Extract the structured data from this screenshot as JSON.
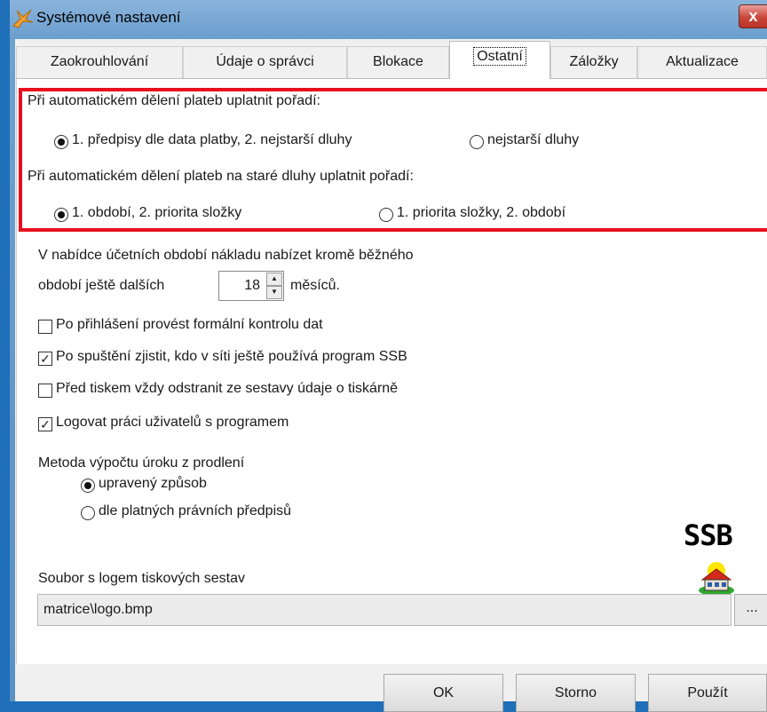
{
  "window": {
    "title": "Systémové nastavení",
    "close_label": "x"
  },
  "tabs": [
    {
      "label": "Zaokrouhlování",
      "active": false
    },
    {
      "label": "Údaje o správci",
      "active": false
    },
    {
      "label": "Blokace",
      "active": false
    },
    {
      "label": "Ostatní",
      "active": true
    },
    {
      "label": "Záložky",
      "active": false
    },
    {
      "label": "Aktualizace",
      "active": false
    }
  ],
  "split_order": {
    "label": "Při automatickém dělení plateb uplatnit pořadí:",
    "options": [
      {
        "label": "1. předpisy dle data platby, 2. nejstarší dluhy",
        "selected": true
      },
      {
        "label": "nejstarší dluhy",
        "selected": false
      }
    ]
  },
  "old_debts_order": {
    "label": "Při automatickém dělení plateb na staré dluhy uplatnit pořadí:",
    "options": [
      {
        "label": "1. období, 2. priorita složky",
        "selected": true
      },
      {
        "label": "1. priorita složky, 2. období",
        "selected": false
      }
    ]
  },
  "periods": {
    "line1": "V nabídce účetních období nákladu nabízet kromě běžného",
    "line2_prefix": "období ještě dalších",
    "value": "18",
    "suffix": "měsíců."
  },
  "checkboxes": [
    {
      "label": "Po přihlášení provést formální kontrolu dat",
      "checked": false
    },
    {
      "label": "Po spuštění zjistit, kdo v síti ještě používá program SSB",
      "checked": true
    },
    {
      "label": "Před tiskem vždy odstranit ze sestavy údaje o tiskárně",
      "checked": false
    },
    {
      "label": "Logovat práci uživatelů s programem",
      "checked": true
    }
  ],
  "interest": {
    "label": "Metoda výpočtu úroku z prodlení",
    "options": [
      {
        "label": "upravený způsob",
        "selected": true
      },
      {
        "label": "dle platných právních předpisů",
        "selected": false
      }
    ]
  },
  "logo": {
    "text": "SSB"
  },
  "logo_file": {
    "label": "Soubor s logem tiskových sestav",
    "value": "matrice\\logo.bmp",
    "browse_label": "..."
  },
  "buttons": {
    "ok": "OK",
    "cancel": "Storno",
    "apply": "Použít"
  },
  "colors": {
    "highlight_border": "#e8101d",
    "title_bar": "#7aa8d6"
  }
}
